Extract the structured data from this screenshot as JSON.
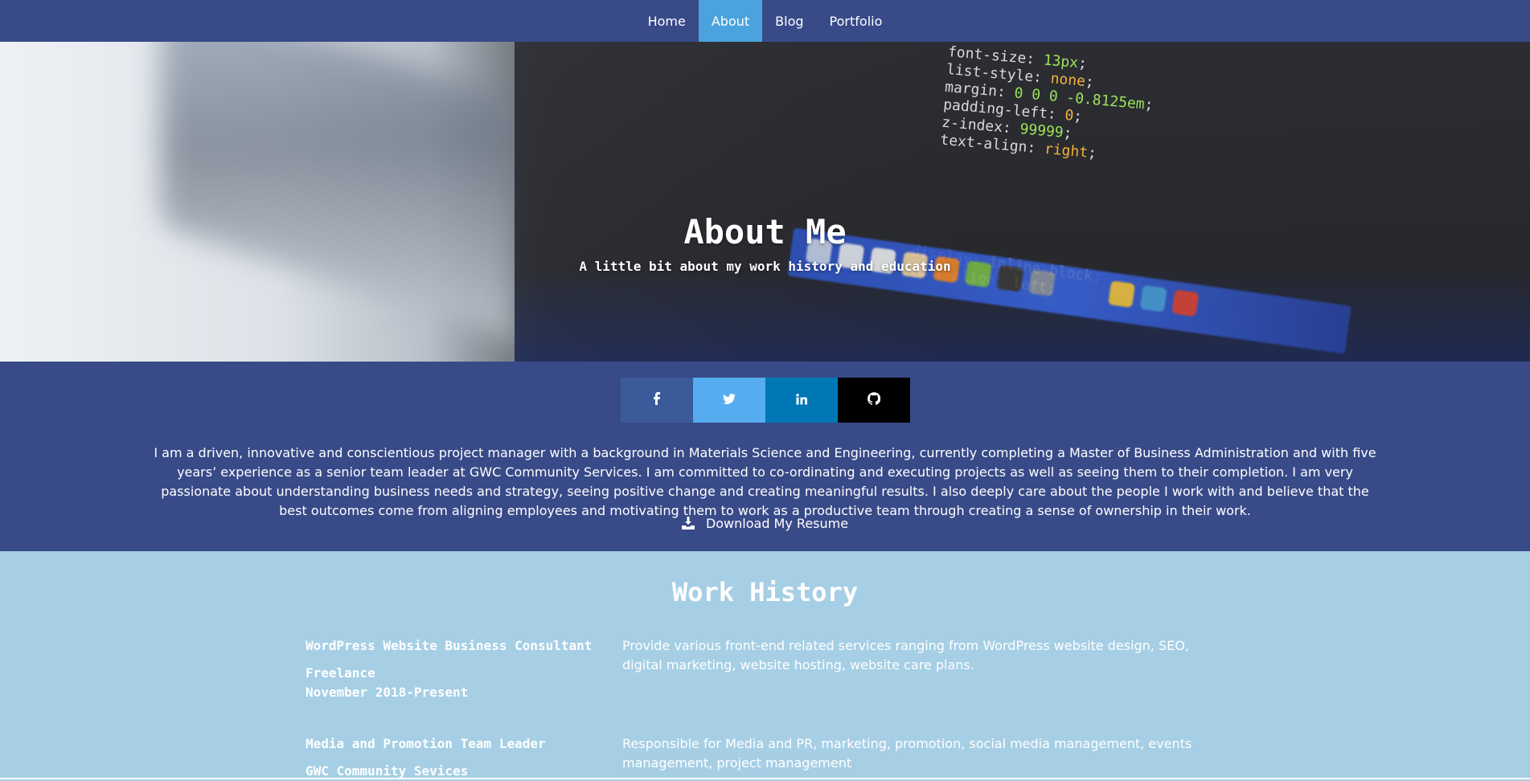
{
  "nav": {
    "items": [
      {
        "label": "Home",
        "active": false
      },
      {
        "label": "About",
        "active": true
      },
      {
        "label": "Blog",
        "active": false
      },
      {
        "label": "Portfolio",
        "active": false
      }
    ]
  },
  "hero": {
    "title": "About Me",
    "subtitle": "A little bit about my work history and education"
  },
  "social": {
    "buttons": [
      {
        "name": "facebook",
        "glyph": "f",
        "color": "#3b5a9a"
      },
      {
        "name": "twitter",
        "glyph": "t",
        "color": "#55acee"
      },
      {
        "name": "linkedin",
        "glyph": "in",
        "color": "#0077b5"
      },
      {
        "name": "github",
        "glyph": "gh",
        "color": "#000000"
      }
    ]
  },
  "about": {
    "bio": "I am a driven, innovative and conscientious project manager with a background in Materials Science and Engineering, currently completing a Master of Business Administration and with five years’ experience as a senior team leader at GWC Community Services. I am committed to co-ordinating and executing projects as well as seeing them to their completion. I am very passionate about understanding business needs and strategy, seeing positive change and creating meaningful results. I also deeply care about the people I work with and believe that the best outcomes come from aligning employees and motivating them to work as a productive team through creating a sense of ownership in their work.",
    "download_label": "Download My Resume"
  },
  "work": {
    "title": "Work History",
    "jobs": [
      {
        "role": "WordPress Website Business Consultant",
        "company": "Freelance",
        "period": "November 2018-Present",
        "description": "Provide various front-end related services ranging from WordPress website design, SEO, digital marketing, website hosting, website care plans."
      },
      {
        "role": "Media and Promotion Team Leader",
        "company": "GWC Community Sevices",
        "period": "",
        "description": "Responsible for Media and PR, marketing, promotion, social media management, events management, project management"
      }
    ]
  },
  "colors": {
    "nav_bg": "#384a88",
    "nav_active": "#4aa3df",
    "about_bg": "#384a88",
    "work_bg": "#a6cfe5"
  }
}
